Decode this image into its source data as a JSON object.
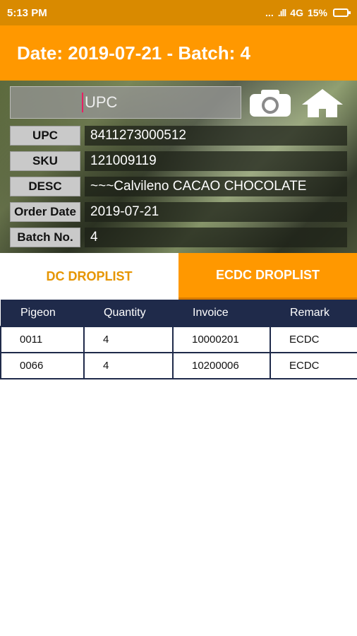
{
  "status_bar": {
    "time": "5:13 PM",
    "dots": "...",
    "signal": ".ıll",
    "network": "4G",
    "battery": "15%"
  },
  "app_bar": {
    "title": "Date: 2019-07-21 - Batch: 4"
  },
  "scan": {
    "upc_placeholder": "UPC",
    "camera_icon": "camera-icon",
    "home_icon": "home-icon"
  },
  "fields": [
    {
      "label": "UPC",
      "value": "8411273000512"
    },
    {
      "label": "SKU",
      "value": "121009119"
    },
    {
      "label": "DESC",
      "value": "~~~Calvileno CACAO CHOCOLATE"
    },
    {
      "label": "Order Date",
      "value": "2019-07-21"
    },
    {
      "label": "Batch No.",
      "value": "4"
    }
  ],
  "tabs": [
    {
      "label": "DC DROPLIST",
      "active": false
    },
    {
      "label": "ECDC DROPLIST",
      "active": true
    }
  ],
  "table": {
    "headers": [
      "Pigeon",
      "Quantity",
      "Invoice",
      "Remark"
    ],
    "rows": [
      [
        "0011",
        "4",
        "10000201",
        "ECDC"
      ],
      [
        "0066",
        "4",
        "10200006",
        "ECDC"
      ]
    ]
  },
  "colors": {
    "status_bar": "#d98a00",
    "accent": "#ff9800",
    "table_header": "#1f2a4a"
  }
}
